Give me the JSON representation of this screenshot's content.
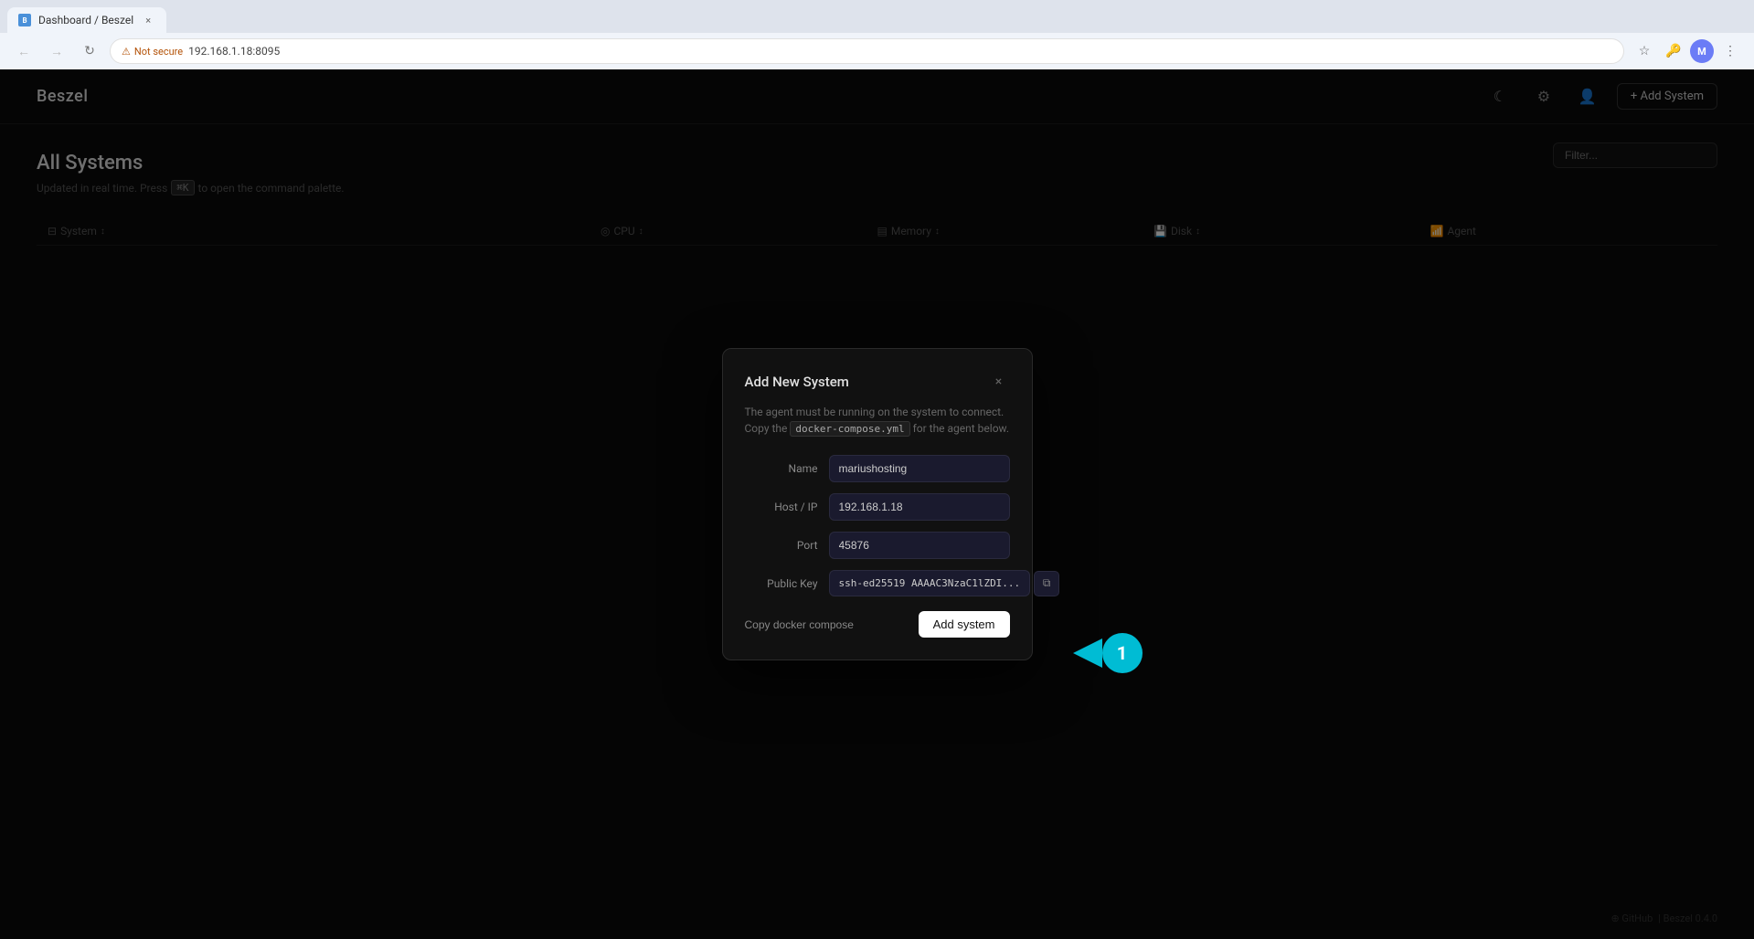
{
  "browser": {
    "tab_label": "Dashboard / Beszel",
    "tab_favicon": "B",
    "not_secure": "Not secure",
    "url": "192.168.1.18:8095",
    "profile_initial": "M"
  },
  "app": {
    "logo": "Beszel",
    "nav_icons": {
      "moon": "☾",
      "settings": "⚙",
      "user": "👤"
    },
    "add_system_btn": "+ Add System",
    "page_title": "All Systems",
    "page_subtitle_text": "Updated in real time. Press",
    "page_subtitle_kbd": "⌘K",
    "page_subtitle_rest": "to open the command palette.",
    "filter_placeholder": "Filter...",
    "table_columns": [
      {
        "label": "System",
        "icon": "↕"
      },
      {
        "label": "CPU",
        "icon": "↕"
      },
      {
        "label": "Memory",
        "icon": "↕"
      },
      {
        "label": "Disk",
        "icon": "↕"
      },
      {
        "label": "Agent"
      }
    ],
    "footer_github": "⊕ GitHub",
    "footer_version": "| Beszel 0.4.0"
  },
  "modal": {
    "title": "Add New System",
    "description_1": "The agent must be running on the system to connect. Copy the",
    "description_code": "docker-compose.yml",
    "description_2": "for the agent below.",
    "fields": {
      "name_label": "Name",
      "name_value": "mariushosting",
      "host_label": "Host / IP",
      "host_value": "192.168.1.18",
      "port_label": "Port",
      "port_value": "45876",
      "public_key_label": "Public Key",
      "public_key_value": "ssh-ed25519 AAAAC3NzaC1lZDI..."
    },
    "copy_docker_label": "Copy docker compose",
    "add_system_label": "Add system",
    "close_icon": "×",
    "copy_icon": "⧉"
  },
  "annotation": {
    "number": "1"
  }
}
